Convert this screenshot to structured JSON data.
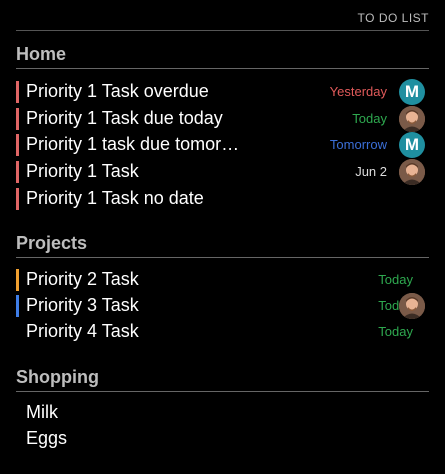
{
  "header": {
    "title": "TO DO LIST"
  },
  "colors": {
    "priority1": "#e06666",
    "priority2": "#f0a030",
    "priority3": "#3f7ee8",
    "overdue": "#e05a5a",
    "today": "#2ea84f",
    "tomorrow": "#3b6fd8",
    "future": "#dddddd"
  },
  "sections": [
    {
      "title": "Home",
      "tasks": [
        {
          "name": "Priority 1 Task overdue",
          "date": "Yesterday",
          "avatar": "M"
        },
        {
          "name": "Priority 1 Task due today",
          "date": "Today",
          "avatar": "photo"
        },
        {
          "name": "Priority 1 task due tomor…",
          "date": "Tomorrow",
          "avatar": "M"
        },
        {
          "name": "Priority 1 Task",
          "date": "Jun 2",
          "avatar": "photo"
        },
        {
          "name": "Priority 1 Task no date",
          "date": "",
          "avatar": ""
        }
      ]
    },
    {
      "title": "Projects",
      "tasks": [
        {
          "name": "Priority 2 Task",
          "date": "Today",
          "avatar": ""
        },
        {
          "name": "Priority 3 Task",
          "date": "Today",
          "avatar": "photo"
        },
        {
          "name": "Priority 4 Task",
          "date": "Today",
          "avatar": ""
        }
      ]
    },
    {
      "title": "Shopping",
      "tasks": [
        {
          "name": "Milk",
          "date": "",
          "avatar": ""
        },
        {
          "name": "Eggs",
          "date": "",
          "avatar": ""
        }
      ]
    }
  ]
}
